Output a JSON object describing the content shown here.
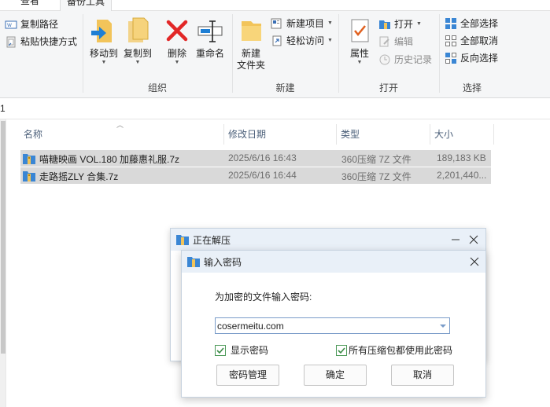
{
  "ribbon": {
    "tabs": {
      "view": "查看",
      "manage": "备份工具"
    },
    "clipboard": {
      "copy_path": "复制路径",
      "paste_shortcut": "粘贴快捷方式"
    },
    "organize": {
      "label": "组织",
      "move_to": "移动到",
      "copy_to": "复制到",
      "delete": "删除",
      "rename": "重命名"
    },
    "new": {
      "label": "新建",
      "new_folder_line1": "新建",
      "new_folder_line2": "文件夹",
      "new_item": "新建项目",
      "easy_access": "轻松访问"
    },
    "open": {
      "label": "打开",
      "properties": "属性",
      "open": "打开",
      "edit": "编辑",
      "history": "历史记录"
    },
    "select": {
      "label": "选择",
      "select_all": "全部选择",
      "select_none": "全部取消",
      "invert": "反向选择"
    }
  },
  "address": {
    "text": "1"
  },
  "list": {
    "columns": [
      "名称",
      "修改日期",
      "类型",
      "大小"
    ],
    "rows": [
      {
        "name": "喵糖映画 VOL.180 加藤惠礼服.7z",
        "date": "2025/6/16 16:43",
        "type": "360压缩 7Z 文件",
        "size": "189,183 KB"
      },
      {
        "name": "走路摇ZLY 合集.7z",
        "date": "2025/6/16 16:44",
        "type": "360压缩 7Z 文件",
        "size": "2,201,440..."
      }
    ]
  },
  "extract_dialog": {
    "title": "正在解压"
  },
  "password_dialog": {
    "title": "输入密码",
    "prompt": "为加密的文件输入密码:",
    "password_value": "cosermeitu.com",
    "show_password": "显示密码",
    "use_for_all": "所有压缩包都使用此密码",
    "manage_button": "密码管理",
    "ok_button": "确定",
    "cancel_button": "取消"
  },
  "colors": {
    "ribbon_bg": "#f5f6f7",
    "selection": "#d9d9d9",
    "dialog_title": "#e9f0f8",
    "delete_red": "#e22727",
    "folder_yellow": "#f2c45a",
    "check_green": "#3a8a45"
  }
}
